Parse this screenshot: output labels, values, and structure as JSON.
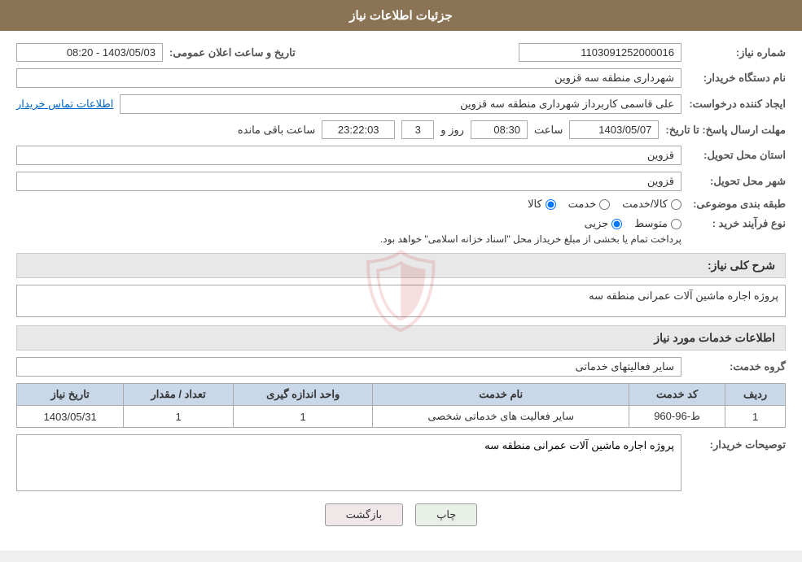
{
  "header": {
    "title": "جزئیات اطلاعات نیاز"
  },
  "fields": {
    "need_number_label": "شماره نیاز:",
    "need_number_value": "1103091252000016",
    "org_name_label": "نام دستگاه خریدار:",
    "org_name_value": "شهرداری منطقه سه قزوین",
    "creator_label": "ایجاد کننده درخواست:",
    "creator_value": "علی قاسمی کاربرداز شهرداری منطقه سه قزوین",
    "contact_link": "اطلاعات تماس خریدار",
    "announce_date_label": "تاریخ و ساعت اعلان عمومی:",
    "announce_date_value": "1403/05/03 - 08:20",
    "deadline_label": "مهلت ارسال پاسخ: تا تاریخ:",
    "deadline_date": "1403/05/07",
    "deadline_time_label": "ساعت",
    "deadline_time_value": "08:30",
    "deadline_day_label": "روز و",
    "deadline_days": "3",
    "deadline_countdown_label": "ساعت باقی مانده",
    "deadline_countdown": "23:22:03",
    "province_label": "استان محل تحویل:",
    "province_value": "قزوین",
    "city_label": "شهر محل تحویل:",
    "city_value": "قزوین",
    "category_label": "طبقه بندی موضوعی:",
    "category_kala": "کالا",
    "category_khadamat": "خدمت",
    "category_kala_khadamat": "کالا/خدمت",
    "purchase_type_label": "نوع فرآیند خرید :",
    "purchase_type_jozi": "جزیی",
    "purchase_type_motavaset": "متوسط",
    "purchase_type_note": "پرداخت تمام یا بخشی از مبلغ خریداز محل \"اسناد خزانه اسلامی\" خواهد بود.",
    "need_desc_label": "شرح کلی نیاز:",
    "need_desc_value": "پروژه اجاره ماشین آلات عمرانی منطقه سه",
    "services_title": "اطلاعات خدمات مورد نیاز",
    "service_group_label": "گروه خدمت:",
    "service_group_value": "سایر فعالیتهای خدماتی",
    "table": {
      "headers": [
        "ردیف",
        "کد خدمت",
        "نام خدمت",
        "واحد اندازه گیری",
        "تعداد / مقدار",
        "تاریخ نیاز"
      ],
      "rows": [
        {
          "row": "1",
          "code": "ط-96-960",
          "name": "سایر فعالیت های خدماتی شخصی",
          "unit": "1",
          "count": "1",
          "date": "1403/05/31"
        }
      ]
    },
    "buyer_desc_label": "توصیحات خریدار:",
    "buyer_desc_value": "پروژه اجاره ماشین آلات عمرانی منطقه سه"
  },
  "buttons": {
    "print_label": "چاپ",
    "back_label": "بازگشت"
  }
}
